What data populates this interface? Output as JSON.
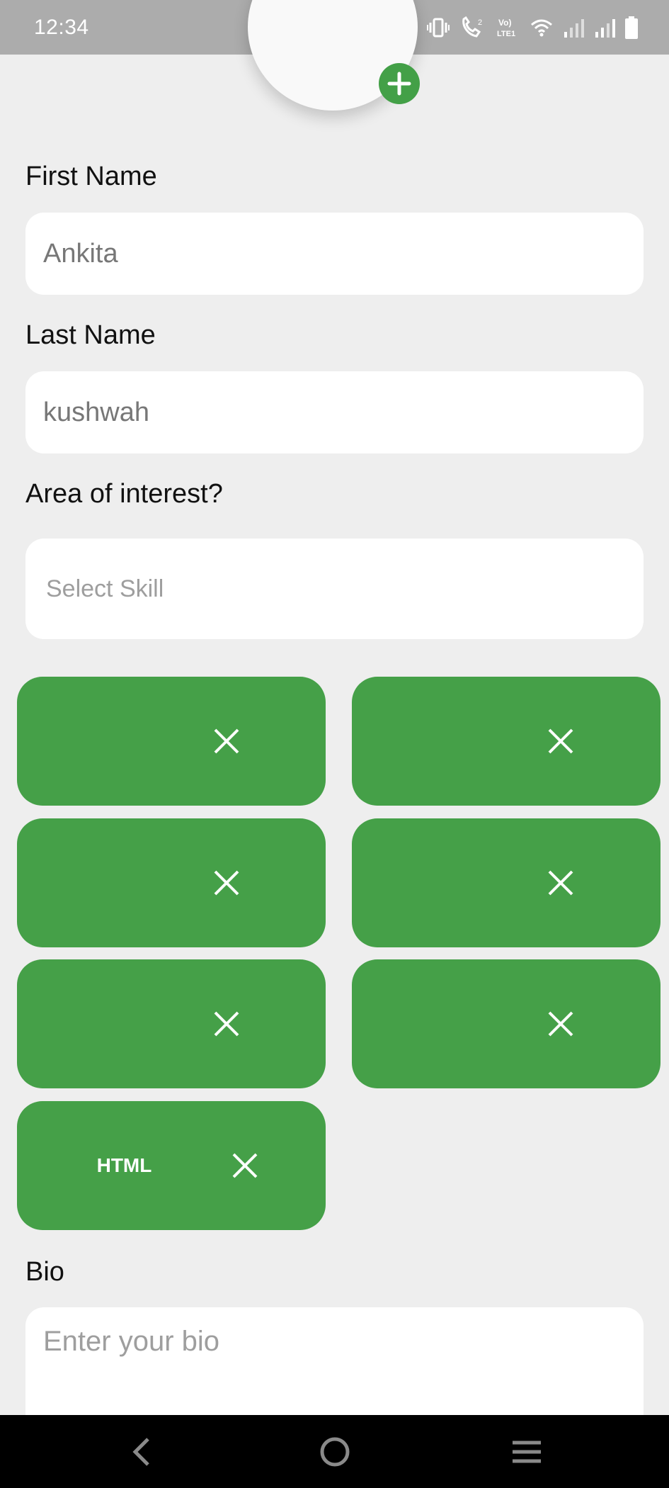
{
  "status_bar": {
    "time": "12:34",
    "icons": [
      "vibrate-icon",
      "wifi-call-icon",
      "volte-icon",
      "wifi-icon",
      "signal-icon",
      "signal-icon",
      "battery-icon"
    ]
  },
  "profile": {
    "add_photo_icon": "plus-icon"
  },
  "form": {
    "first_name_label": "First Name",
    "first_name_value": "Ankita",
    "last_name_label": "Last Name",
    "last_name_value": "kushwah",
    "interest_label": "Area of interest?",
    "skill_placeholder": "Select Skill",
    "skills": [
      "",
      "",
      "",
      "",
      "",
      "",
      "HTML"
    ],
    "bio_label": "Bio",
    "bio_placeholder": "Enter your bio"
  },
  "nav": {
    "back_icon": "back-icon",
    "home_icon": "home-icon",
    "menu_icon": "menu-icon"
  },
  "colors": {
    "accent": "#45a048",
    "background": "#eeeeee",
    "status_bar": "#acacac",
    "nav_bar": "#000000"
  }
}
